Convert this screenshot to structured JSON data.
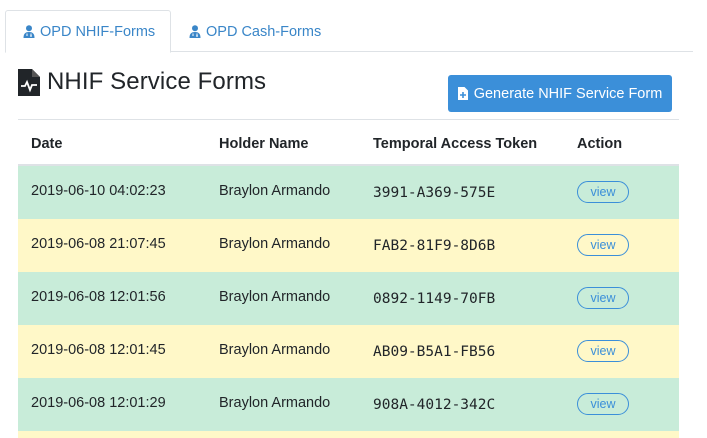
{
  "tabs": [
    {
      "label": "OPD NHIF-Forms",
      "active": true
    },
    {
      "label": "OPD Cash-Forms",
      "active": false
    }
  ],
  "heading": {
    "title": "NHIF Service Forms"
  },
  "generate_button": {
    "label": "Generate NHIF Service Form"
  },
  "table": {
    "columns": [
      "Date",
      "Holder Name",
      "Temporal Access Token",
      "Action"
    ],
    "rows": [
      {
        "date": "2019-06-10 04:02:23",
        "holder": "Braylon Armando",
        "token": "3991-A369-575E",
        "action": "view"
      },
      {
        "date": "2019-06-08 21:07:45",
        "holder": "Braylon Armando",
        "token": "FAB2-81F9-8D6B",
        "action": "view"
      },
      {
        "date": "2019-06-08 12:01:56",
        "holder": "Braylon Armando",
        "token": "0892-1149-70FB",
        "action": "view"
      },
      {
        "date": "2019-06-08 12:01:45",
        "holder": "Braylon Armando",
        "token": "AB09-B5A1-FB56",
        "action": "view"
      },
      {
        "date": "2019-06-08 12:01:29",
        "holder": "Braylon Armando",
        "token": "908A-4012-342C",
        "action": "view"
      }
    ]
  },
  "colors": {
    "accent": "#3b8fd9",
    "row_green": "#c8ecd9",
    "row_yellow": "#fff8c8"
  },
  "icons": {
    "tab": "user-md-icon",
    "heading": "file-medical-icon",
    "button": "file-plus-icon"
  }
}
